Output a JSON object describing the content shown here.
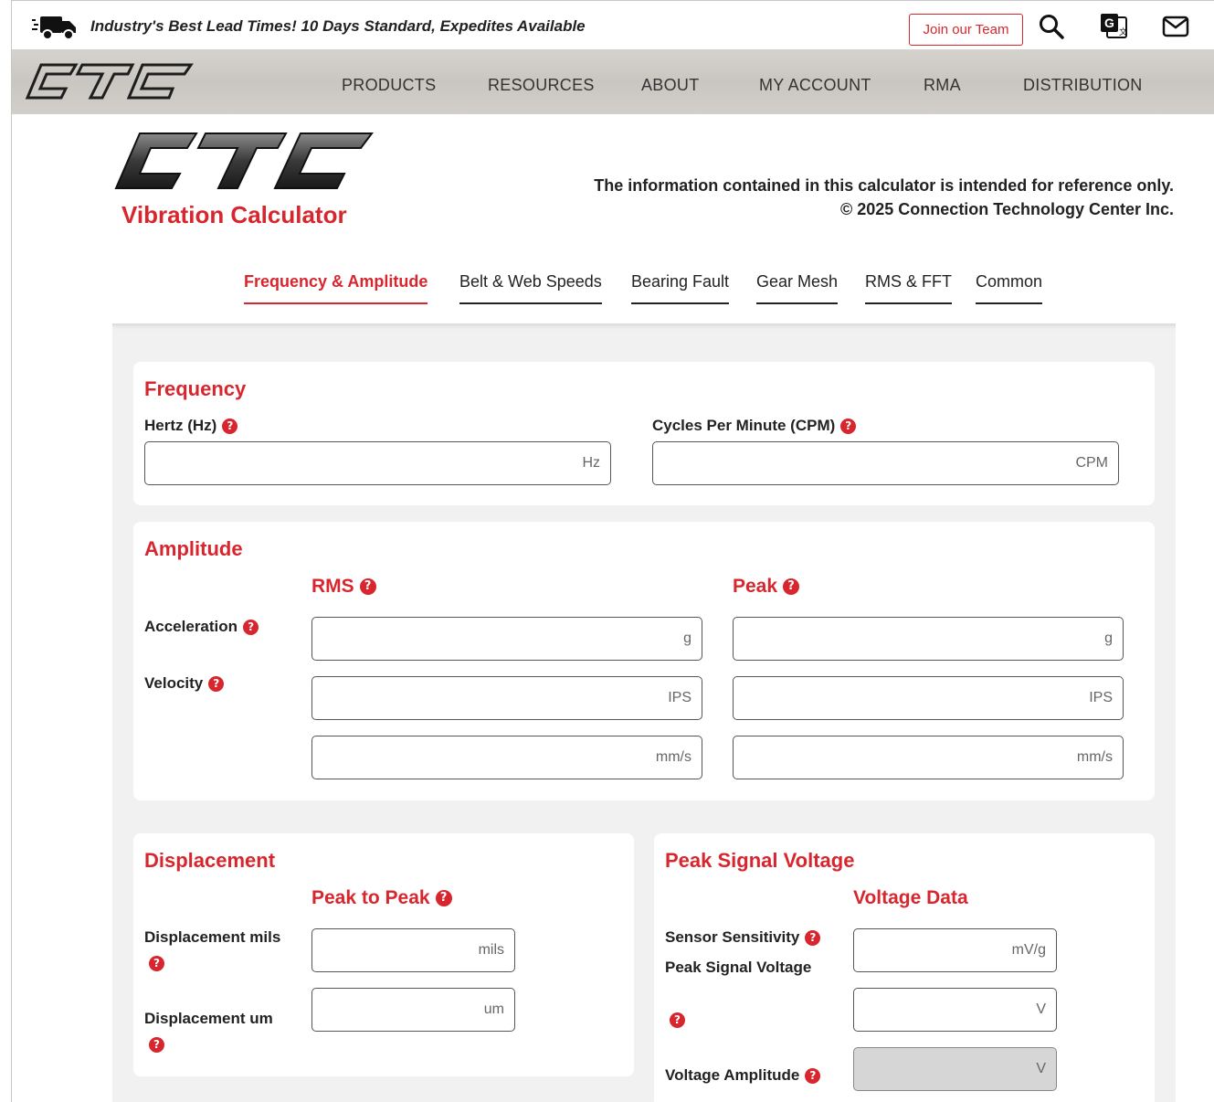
{
  "topbar": {
    "promo": "Industry's Best Lead Times! 10 Days Standard, Expedites Available",
    "join_label": "Join our Team",
    "icons": [
      "truck-icon",
      "search-icon",
      "translate-icon",
      "mail-icon"
    ]
  },
  "nav": {
    "items": [
      "PRODUCTS",
      "RESOURCES",
      "ABOUT",
      "MY ACCOUNT",
      "RMA",
      "DISTRIBUTION"
    ]
  },
  "header": {
    "title": "Vibration Calculator",
    "disclaimer_line1": "The information contained in this calculator is intended for reference only.",
    "disclaimer_line2": "© 2025 Connection Technology Center Inc."
  },
  "tabs": [
    "Frequency & Amplitude",
    "Belt & Web Speeds",
    "Bearing Fault",
    "Gear Mesh",
    "RMS & FFT",
    "Common"
  ],
  "active_tab": "Frequency & Amplitude",
  "frequency": {
    "title": "Frequency",
    "hz_label": "Hertz (Hz)",
    "hz_unit": "Hz",
    "cpm_label": "Cycles Per Minute (CPM)",
    "cpm_unit": "CPM"
  },
  "amplitude": {
    "title": "Amplitude",
    "rms_head": "RMS",
    "peak_head": "Peak",
    "accel_label": "Acceleration",
    "velocity_label": "Velocity",
    "units": {
      "g": "g",
      "ips": "IPS",
      "mms": "mm/s"
    }
  },
  "displacement": {
    "title": "Displacement",
    "col_head": "Peak to Peak",
    "mils_label": "Displacement mils",
    "mils_unit": "mils",
    "um_label": "Displacement um",
    "um_unit": "um"
  },
  "signal": {
    "title": "Peak Signal Voltage",
    "col_head": "Voltage Data",
    "sensitivity_label": "Sensor Sensitivity",
    "sensitivity_unit": "mV/g",
    "peak_label": "Peak Signal Voltage",
    "peak_unit": "V",
    "amplitude_label": "Voltage Amplitude",
    "amplitude_unit": "V"
  },
  "colors": {
    "accent": "#d7262e",
    "panel": "#f1f1f1",
    "nav": "#cfccc7"
  }
}
